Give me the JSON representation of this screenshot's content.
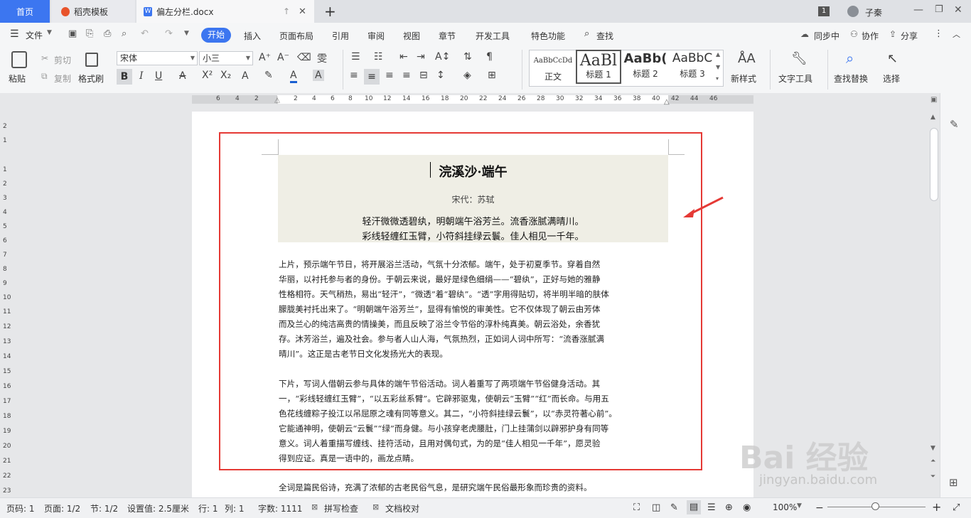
{
  "tabs": {
    "home": "首页",
    "daoke": "稻壳模板",
    "doc": "偏左分栏.docx",
    "add": "+",
    "user": "子秦",
    "badge": "1"
  },
  "menu": {
    "file": "文件",
    "start": "开始",
    "insert": "插入",
    "layout": "页面布局",
    "reference": "引用",
    "review": "审阅",
    "view": "视图",
    "chapter": "章节",
    "dev": "开发工具",
    "special": "特色功能",
    "search": "查找",
    "sync": "同步中",
    "collab": "协作",
    "share": "分享"
  },
  "ribbon": {
    "paste": "粘贴",
    "cut": "剪切",
    "copy": "复制",
    "format_painter": "格式刷",
    "font": "宋体",
    "size": "小三",
    "styles": [
      {
        "preview": "AaBbCcDd",
        "label": "正文"
      },
      {
        "preview": "AaBl",
        "label": "标题 1"
      },
      {
        "preview": "AaBb(",
        "label": "标题 2"
      },
      {
        "preview": "AaBbC",
        "label": "标题 3"
      }
    ],
    "new_style": "新样式",
    "text_tools": "文字工具",
    "find_replace": "查找替换",
    "select": "选择"
  },
  "ruler": {
    "h": [
      "6",
      "4",
      "2",
      "2",
      "4",
      "6",
      "8",
      "10",
      "12",
      "14",
      "16",
      "18",
      "20",
      "22",
      "24",
      "26",
      "28",
      "30",
      "32",
      "34",
      "36",
      "38",
      "40",
      "42",
      "44",
      "46"
    ],
    "v": [
      "2",
      "1",
      "1",
      "2",
      "3",
      "4",
      "5",
      "6",
      "7",
      "8",
      "9",
      "10",
      "11",
      "12",
      "13",
      "14",
      "15",
      "16",
      "17",
      "18",
      "19",
      "20",
      "21",
      "22",
      "23"
    ]
  },
  "document": {
    "title": "浣溪沙·端午",
    "author": "宋代：苏轼",
    "line1": "轻汗微微透碧纨，明朝端午浴芳兰。流香涨腻满晴川。",
    "line2": "彩线轻缠红玉臂，小符斜挂绿云鬟。佳人相见一千年。",
    "para1": [
      "上片，预示端午节日，将开展浴兰活动，气氛十分浓郁。端午，处于初夏季节。穿着自然",
      "华丽，以衬托参与者的身份。于朝云来说，最好是绿色细绢——“碧纨”，正好与她的雅静",
      "性格相符。天气稍热，易出“轻汗”，“微透”着“碧纨”。“透”字用得贴切，将半明半暗的肤体",
      "朦胧美衬托出来了。“明朝端午浴芳兰”，显得有愉悦的审美性。它不仅体现了朝云由芳体",
      "而及兰心的纯洁高贵的情操美，而且反映了浴兰令节俗的淳朴纯真美。朝云浴处，余香犹",
      "存。沐芳浴兰，遍及社会。参与者人山人海，气氛热烈，正如词人词中所写：“流香涨腻满",
      "晴川”。这正是古老节日文化发扬光大的表现。"
    ],
    "para2": [
      "下片，写词人借朝云参与具体的端午节俗活动。词人着重写了两项端午节俗健身活动。其",
      "一，“彩线轻缠红玉臂”，“以五彩丝系臂”。它辟邪驱鬼，使朝云“玉臂”“红”而长命。与用五",
      "色花线缠粽子投江以吊屈原之魂有同等意义。其二，“小符斜挂绿云鬟”，以“赤灵符著心前”。",
      "它能通神明，使朝云“云鬟”“绿”而身健。与小孩穿老虎腰肚，门上挂蒲剑以辟邪护身有同等",
      "意义。词人着重描写缠线、挂符活动，且用对偶句式，为的是“佳人相见一千年”，愿灵验",
      "得到应证。真是一语中的，画龙点睛。"
    ],
    "para3": "全词是篇民俗诗，充满了浓郁的古老民俗气息，是研究端午民俗最形象而珍贵的资料。"
  },
  "status": {
    "page_no": "页码: 1",
    "pages": "页面: 1/2",
    "section": "节: 1/2",
    "setting": "设置值: 2.5厘米",
    "row": "行: 1",
    "col": "列: 1",
    "words": "字数: 1111",
    "spell": "拼写检查",
    "proof": "文档校对",
    "zoom": "100%",
    "minus": "−",
    "plus": "+"
  },
  "watermark": {
    "main": "Bai 经验",
    "sub": "jingyan.baidu.com"
  },
  "colors": {
    "accent": "#3c76f0",
    "highlight": "#e53935",
    "band": "#efeee5"
  }
}
